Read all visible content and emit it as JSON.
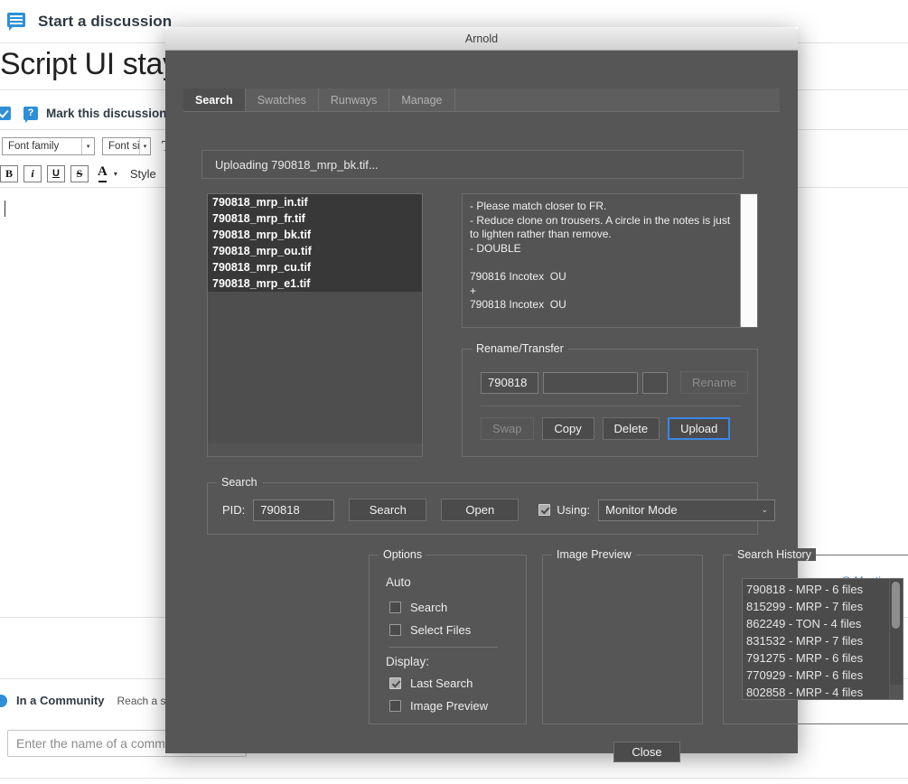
{
  "background": {
    "discussion_header": "Start a discussion",
    "page_title": "Script UI stayin",
    "mark_label": "Mark this discussion as a",
    "question_badge": "?",
    "toolbar": {
      "font_family": "Font family",
      "font_size": "Font si",
      "format_glyph": "T",
      "bold": "B",
      "italic": "i",
      "underline": "U",
      "strikethrough": "S",
      "text_color": "A",
      "color_arrow": "▾",
      "style_label": "Style",
      "select_arrow": "▾"
    },
    "mention": "@ Mention",
    "community_title": "In a Community",
    "community_sub": "Reach a spec",
    "community_placeholder": "Enter the name of a commu"
  },
  "dialog": {
    "title": "Arnold",
    "tabs": [
      {
        "label": "Search",
        "active": true
      },
      {
        "label": "Swatches",
        "active": false
      },
      {
        "label": "Runways",
        "active": false
      },
      {
        "label": "Manage",
        "active": false
      }
    ],
    "status_text": "Uploading 790818_mrp_bk.tif...",
    "file_list": [
      {
        "name": "790818_mrp_in.tif",
        "selected": true
      },
      {
        "name": "790818_mrp_fr.tif",
        "selected": true
      },
      {
        "name": "790818_mrp_bk.tif",
        "selected": true
      },
      {
        "name": "790818_mrp_ou.tif",
        "selected": true
      },
      {
        "name": "790818_mrp_cu.tif",
        "selected": true
      },
      {
        "name": "790818_mrp_e1.tif",
        "selected": true
      }
    ],
    "notes": "- Please match closer to FR.\n- Reduce clone on trousers. A circle in the notes is just\nto lighten rather than remove.\n- DOUBLE\n\n790816 Incotex  OU\n+\n790818 Incotex  OU",
    "rename_transfer": {
      "legend": "Rename/Transfer",
      "field1": "790818",
      "field2": "",
      "field3": "",
      "rename_label": "Rename",
      "swap_label": "Swap",
      "copy_label": "Copy",
      "delete_label": "Delete",
      "upload_label": "Upload"
    },
    "search": {
      "legend": "Search",
      "pid_label": "PID:",
      "pid_value": "790818",
      "search_label": "Search",
      "open_label": "Open",
      "using_label": "Using:",
      "using_checked": true,
      "mode_value": "Monitor Mode",
      "mode_chevron": "⌄"
    },
    "options": {
      "legend": "Options",
      "auto_label": "Auto",
      "auto_search": {
        "label": "Search",
        "checked": false
      },
      "auto_select_files": {
        "label": "Select Files",
        "checked": false
      },
      "display_label": "Display:",
      "display_last_search": {
        "label": "Last Search",
        "checked": true
      },
      "display_image_preview": {
        "label": "Image Preview",
        "checked": false
      }
    },
    "image_preview": {
      "legend": "Image Preview"
    },
    "search_history": {
      "legend": "Search History",
      "items": [
        "790818 - MRP - 6 files",
        "815299 - MRP - 7 files",
        "862249 - TON - 4 files",
        "831532 - MRP - 7 files",
        "791275 - MRP - 6 files",
        "770929 - MRP - 6 files",
        "802858 - MRP - 4 files"
      ]
    },
    "close_label": "Close"
  },
  "colors": {
    "dialog_bg": "#565656",
    "focus_ring": "#3a86e8",
    "accent_blue": "#2d8fd5",
    "link_blue": "#2a6bbd"
  }
}
